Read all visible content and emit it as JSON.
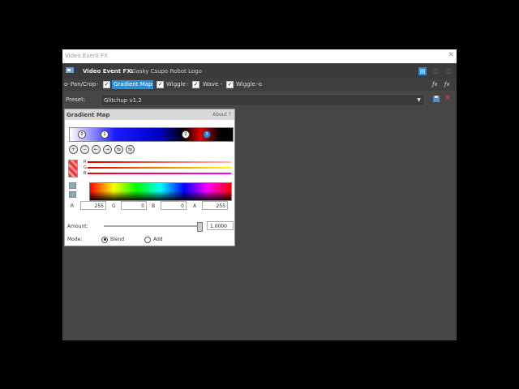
{
  "window": {
    "title": "Video Event FX",
    "close_glyph": "✕"
  },
  "header": {
    "label": "Video Event FX:",
    "source": "Klasky Csupo Robot Logo",
    "view_buttons": [
      "▤",
      "◫",
      "◫"
    ]
  },
  "chain": {
    "items": [
      {
        "label": "Pan/Crop",
        "checked": false,
        "selected": false
      },
      {
        "label": "Gradient Map",
        "checked": true,
        "selected": true
      },
      {
        "label": "Wiggle",
        "checked": true,
        "selected": false
      },
      {
        "label": "Wave",
        "checked": true,
        "selected": false
      },
      {
        "label": "Wiggle",
        "checked": true,
        "selected": false
      }
    ]
  },
  "preset": {
    "label": "Preset:",
    "value": "Glitchup v1.2"
  },
  "panel": {
    "title": "Gradient Map",
    "about": "About ?",
    "stops": [
      "0",
      "1",
      "2",
      "3"
    ],
    "tools": [
      "+",
      "−",
      "←",
      "→",
      "⇆",
      "⇆"
    ],
    "slider_letters": [
      "R",
      "G",
      "B"
    ],
    "fields": [
      {
        "label": "R",
        "value": "255"
      },
      {
        "label": "G",
        "value": "0"
      },
      {
        "label": "B",
        "value": "0"
      },
      {
        "label": "A",
        "value": "255"
      }
    ],
    "amount": {
      "label": "Amount:",
      "value": "1.0000",
      "fraction": 0.99
    },
    "mode": {
      "label": "Mode:",
      "options": [
        "Blend",
        "Add"
      ],
      "selected": "Blend"
    }
  }
}
